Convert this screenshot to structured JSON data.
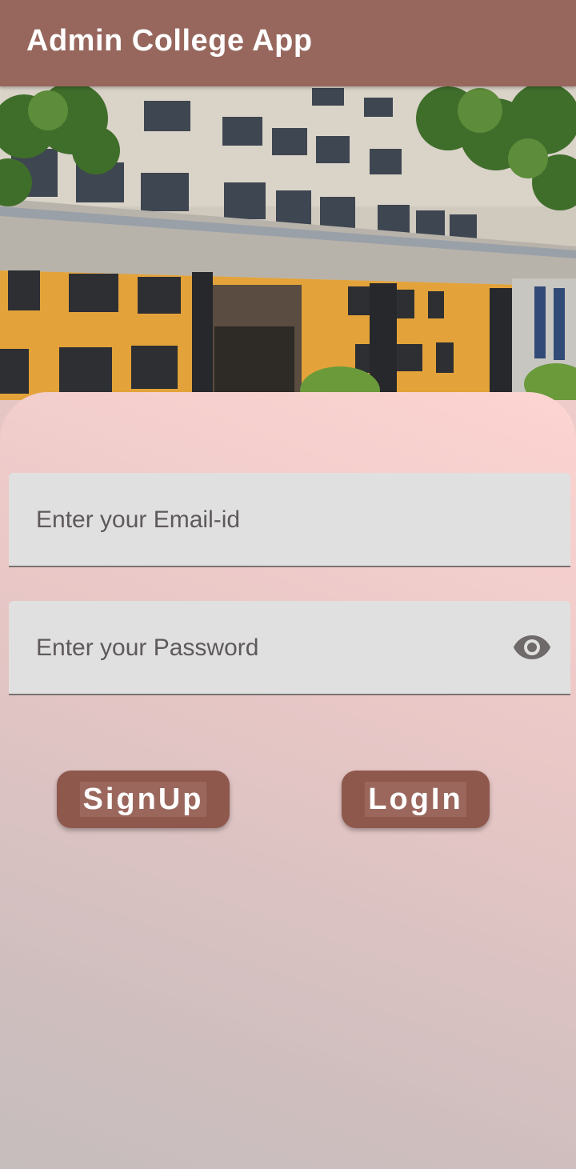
{
  "appbar": {
    "title": "Admin College App"
  },
  "hero": {
    "image": "college-building-photo"
  },
  "form": {
    "email_placeholder": "Enter your Email-id",
    "email_value": "",
    "password_placeholder": "Enter your Password",
    "password_value": "",
    "password_toggle_icon": "eye-icon"
  },
  "buttons": {
    "signup_label": "SignUp",
    "login_label": "LogIn"
  },
  "colors": {
    "appbar": "#97675d",
    "button": "#8e584d",
    "field_bg": "#e1e0e0"
  }
}
